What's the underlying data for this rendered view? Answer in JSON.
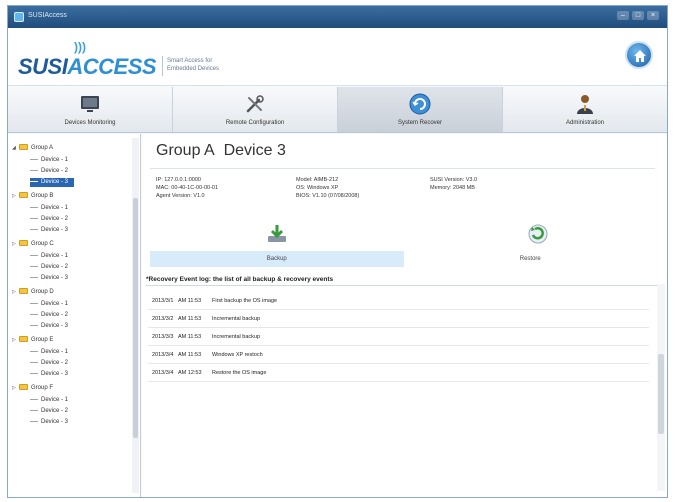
{
  "window": {
    "title": "SUSIAccess"
  },
  "header": {
    "logo_part1": "SUSI",
    "logo_part2": "ACCESS",
    "tagline_line1": "Smart Access for",
    "tagline_line2": "Embedded Devices"
  },
  "tabs": [
    {
      "label": "Devices Monitoring",
      "icon": "monitor-icon"
    },
    {
      "label": "Remote Configuration",
      "icon": "tools-icon"
    },
    {
      "label": "System Recover",
      "icon": "recover-icon",
      "active": true
    },
    {
      "label": "Administration",
      "icon": "admin-user-icon"
    }
  ],
  "tree": {
    "groups": [
      {
        "name": "Group A",
        "devices": [
          "Device - 1",
          "Device - 2",
          "Device - 3"
        ]
      },
      {
        "name": "Group B",
        "devices": [
          "Device - 1",
          "Device - 2",
          "Device - 3"
        ]
      },
      {
        "name": "Group C",
        "devices": [
          "Device - 1",
          "Device - 2",
          "Device - 3"
        ]
      },
      {
        "name": "Group D",
        "devices": [
          "Device - 1",
          "Device - 2",
          "Device - 3"
        ]
      },
      {
        "name": "Group E",
        "devices": [
          "Device - 1",
          "Device - 2",
          "Device - 3"
        ]
      },
      {
        "name": "Group F",
        "devices": [
          "Device - 1",
          "Device - 2",
          "Device - 3"
        ]
      }
    ],
    "selected": "Group A / Device - 3"
  },
  "device": {
    "group": "Group A",
    "name": "Device 3",
    "ip": "IP: 127.0.0.1:0000",
    "mac": "MAC: 00-40-1C-00-00-01",
    "agent_version": "Agent Version: V1.0",
    "model": "Model: AIMB-212",
    "os": "OS: Windows XP",
    "bios": "BIOS: V1.10 (07/08/2008)",
    "susi_version": "SUSI Version: V3.0",
    "memory": "Memory: 2048 MB"
  },
  "actions": {
    "backup_label": "Backup",
    "restore_label": "Restore",
    "active": "Backup"
  },
  "recovery": {
    "heading": "*Recovery Event log: the list of all backup & recovery events",
    "events": [
      {
        "date": "2013/3/1",
        "time": "AM 11:53",
        "description": "First backup the OS image"
      },
      {
        "date": "2013/3/2",
        "time": "AM 11:53",
        "description": "Incremental backup"
      },
      {
        "date": "2013/3/3",
        "time": "AM 11:53",
        "description": "Incremental backup"
      },
      {
        "date": "2013/3/4",
        "time": "AM 11:53",
        "description": "Windows XP restoch"
      },
      {
        "date": "2013/3/4",
        "time": "AM 12:53",
        "description": "Restore the OS image"
      }
    ]
  },
  "colors": {
    "titlebar": "#1f4d7c",
    "logo_dark": "#1e5a9c",
    "logo_light": "#2e8fd4",
    "selection": "#2a66b2",
    "active_action_tab": "#d8ebfa"
  }
}
